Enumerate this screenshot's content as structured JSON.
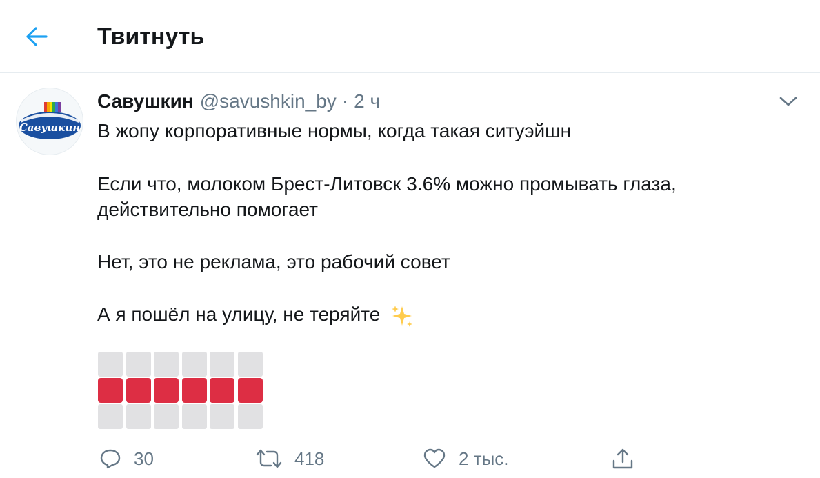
{
  "header": {
    "title": "Твитнуть",
    "back_icon": "arrow-left-icon"
  },
  "colors": {
    "accent": "#1da1f2",
    "text_primary": "#14171a",
    "text_secondary": "#657786",
    "divider": "#e6ecf0",
    "emoji_red": "#dd2e44",
    "emoji_gray": "#e1e1e3",
    "sparkle": "#ffcc4d"
  },
  "tweet": {
    "avatar_label": "Савушкин",
    "author_name": "Савушкин",
    "author_handle": "@savushkin_by",
    "separator": "·",
    "time": "2 ч",
    "menu_icon": "chevron-down-icon",
    "lines": [
      "В жопу корпоративные нормы, когда такая ситуэйшн",
      "Если что, молоком Брест-Литовск 3.6% можно промывать глаза,",
      "действительно помогает",
      "Нет, это не реклама, это рабочий совет",
      "А я пошёл на улицу, не теряйте"
    ],
    "trailing_emoji": "sparkles-icon",
    "emoji_grid_rows": [
      [
        "gray",
        "gray",
        "gray",
        "gray",
        "gray",
        "gray"
      ],
      [
        "red",
        "red",
        "red",
        "red",
        "red",
        "red"
      ],
      [
        "gray",
        "gray",
        "gray",
        "gray",
        "gray",
        "gray"
      ]
    ]
  },
  "actions": {
    "reply": {
      "icon": "reply-icon",
      "count": "30"
    },
    "retweet": {
      "icon": "retweet-icon",
      "count": "418"
    },
    "like": {
      "icon": "heart-icon",
      "count": "2 тыс."
    },
    "share": {
      "icon": "share-icon"
    }
  }
}
